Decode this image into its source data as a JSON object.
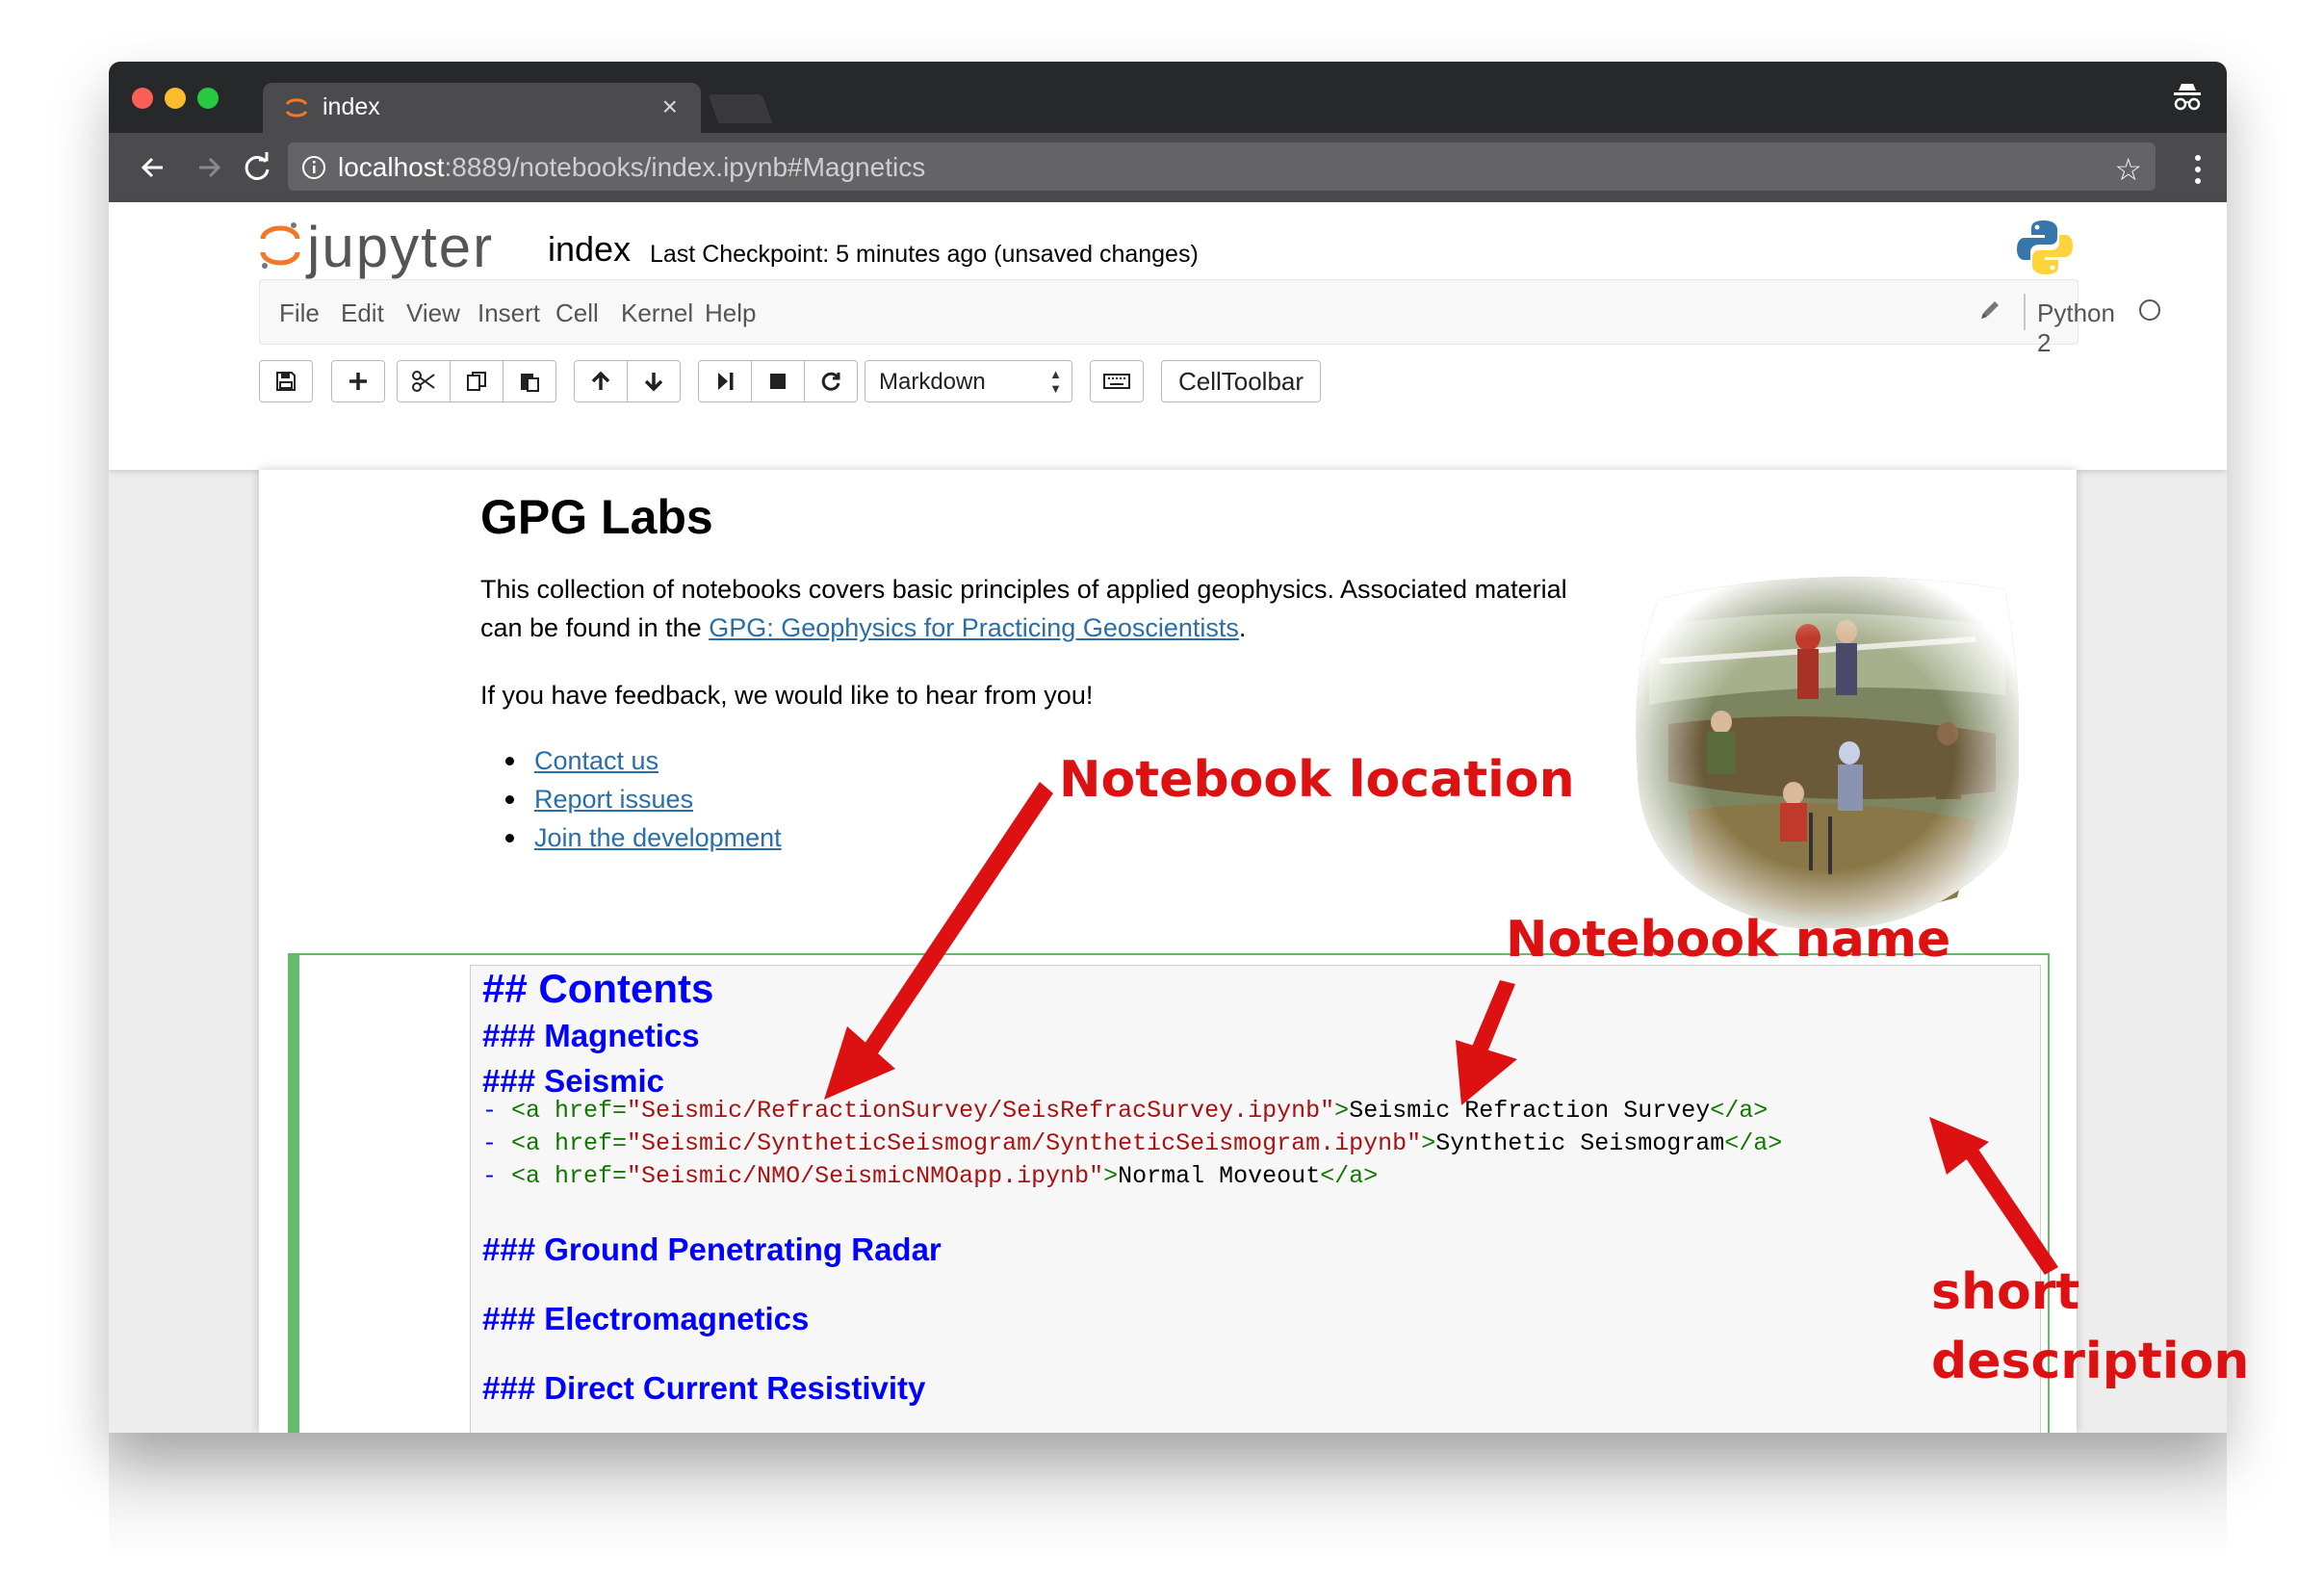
{
  "browser": {
    "tab_title": "index",
    "tab_close": "×",
    "url_host": "localhost",
    "url_rest": ":8889/notebooks/index.ipynb#Magnetics"
  },
  "jupyter": {
    "logo_text": "jupyter",
    "notebook_name": "index",
    "checkpoint": "Last Checkpoint: 5 minutes ago (unsaved changes)",
    "menu": [
      "File",
      "Edit",
      "View",
      "Insert",
      "Cell",
      "Kernel",
      "Help"
    ],
    "kernel": "Python 2",
    "cell_type": "Markdown",
    "celltoolbar_label": "CellToolbar"
  },
  "notebook": {
    "title": "GPG Labs",
    "intro_prefix": "This collection of notebooks covers basic principles of applied geophysics. Associated material",
    "intro_line2_prefix": "can be found in the ",
    "intro_link": "GPG: Geophysics for Practicing Geoscientists",
    "intro_suffix": ".",
    "feedback": "If you have feedback, we would like to hear from you!",
    "links": [
      "Contact us",
      "Report issues",
      "Join the development"
    ]
  },
  "cell": {
    "contents_heading": "## Contents",
    "magnetics_heading": "### Magnetics",
    "seismic_heading": "### Seismic",
    "code_lines": [
      {
        "dash": "- ",
        "open": "<a href=",
        "path": "\"Seismic/RefractionSurvey/SeisRefracSurvey.ipynb\"",
        "close_open": ">",
        "name": "Seismic Refraction Survey",
        "end": "</a>"
      },
      {
        "dash": "- ",
        "open": "<a href=",
        "path": "\"Seismic/SyntheticSeismogram/SyntheticSeismogram.ipynb\"",
        "close_open": ">",
        "name": "Synthetic Seismogram",
        "end": "</a>"
      },
      {
        "dash": "- ",
        "open": "<a href=",
        "path": "\"Seismic/NMO/SeismicNMOapp.ipynb\"",
        "close_open": ">",
        "name": "Normal Moveout",
        "end": "</a>"
      }
    ],
    "gpr_heading": "### Ground Penetrating Radar",
    "em_heading": "### Electromagnetics",
    "dc_heading": "### Direct Current Resistivity"
  },
  "annotations": {
    "location": "Notebook location",
    "name": "Notebook name",
    "short": "short",
    "description": "description"
  },
  "colors": {
    "annotation_red": "#dd1111",
    "markdown_blue": "#0000ff",
    "selected_cell_green": "#66bb6a",
    "link_blue": "#296eaa"
  }
}
